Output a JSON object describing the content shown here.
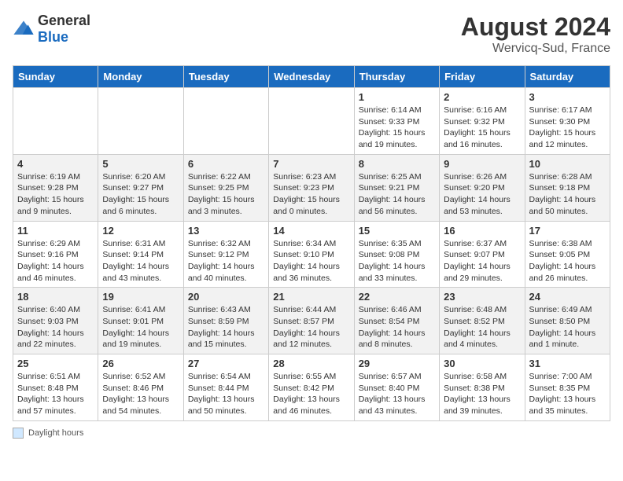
{
  "header": {
    "logo_general": "General",
    "logo_blue": "Blue",
    "month_year": "August 2024",
    "location": "Wervicq-Sud, France"
  },
  "legend": {
    "label": "Daylight hours"
  },
  "days_of_week": [
    "Sunday",
    "Monday",
    "Tuesday",
    "Wednesday",
    "Thursday",
    "Friday",
    "Saturday"
  ],
  "weeks": [
    [
      {
        "day": "",
        "info": ""
      },
      {
        "day": "",
        "info": ""
      },
      {
        "day": "",
        "info": ""
      },
      {
        "day": "",
        "info": ""
      },
      {
        "day": "1",
        "info": "Sunrise: 6:14 AM\nSunset: 9:33 PM\nDaylight: 15 hours and 19 minutes."
      },
      {
        "day": "2",
        "info": "Sunrise: 6:16 AM\nSunset: 9:32 PM\nDaylight: 15 hours and 16 minutes."
      },
      {
        "day": "3",
        "info": "Sunrise: 6:17 AM\nSunset: 9:30 PM\nDaylight: 15 hours and 12 minutes."
      }
    ],
    [
      {
        "day": "4",
        "info": "Sunrise: 6:19 AM\nSunset: 9:28 PM\nDaylight: 15 hours and 9 minutes."
      },
      {
        "day": "5",
        "info": "Sunrise: 6:20 AM\nSunset: 9:27 PM\nDaylight: 15 hours and 6 minutes."
      },
      {
        "day": "6",
        "info": "Sunrise: 6:22 AM\nSunset: 9:25 PM\nDaylight: 15 hours and 3 minutes."
      },
      {
        "day": "7",
        "info": "Sunrise: 6:23 AM\nSunset: 9:23 PM\nDaylight: 15 hours and 0 minutes."
      },
      {
        "day": "8",
        "info": "Sunrise: 6:25 AM\nSunset: 9:21 PM\nDaylight: 14 hours and 56 minutes."
      },
      {
        "day": "9",
        "info": "Sunrise: 6:26 AM\nSunset: 9:20 PM\nDaylight: 14 hours and 53 minutes."
      },
      {
        "day": "10",
        "info": "Sunrise: 6:28 AM\nSunset: 9:18 PM\nDaylight: 14 hours and 50 minutes."
      }
    ],
    [
      {
        "day": "11",
        "info": "Sunrise: 6:29 AM\nSunset: 9:16 PM\nDaylight: 14 hours and 46 minutes."
      },
      {
        "day": "12",
        "info": "Sunrise: 6:31 AM\nSunset: 9:14 PM\nDaylight: 14 hours and 43 minutes."
      },
      {
        "day": "13",
        "info": "Sunrise: 6:32 AM\nSunset: 9:12 PM\nDaylight: 14 hours and 40 minutes."
      },
      {
        "day": "14",
        "info": "Sunrise: 6:34 AM\nSunset: 9:10 PM\nDaylight: 14 hours and 36 minutes."
      },
      {
        "day": "15",
        "info": "Sunrise: 6:35 AM\nSunset: 9:08 PM\nDaylight: 14 hours and 33 minutes."
      },
      {
        "day": "16",
        "info": "Sunrise: 6:37 AM\nSunset: 9:07 PM\nDaylight: 14 hours and 29 minutes."
      },
      {
        "day": "17",
        "info": "Sunrise: 6:38 AM\nSunset: 9:05 PM\nDaylight: 14 hours and 26 minutes."
      }
    ],
    [
      {
        "day": "18",
        "info": "Sunrise: 6:40 AM\nSunset: 9:03 PM\nDaylight: 14 hours and 22 minutes."
      },
      {
        "day": "19",
        "info": "Sunrise: 6:41 AM\nSunset: 9:01 PM\nDaylight: 14 hours and 19 minutes."
      },
      {
        "day": "20",
        "info": "Sunrise: 6:43 AM\nSunset: 8:59 PM\nDaylight: 14 hours and 15 minutes."
      },
      {
        "day": "21",
        "info": "Sunrise: 6:44 AM\nSunset: 8:57 PM\nDaylight: 14 hours and 12 minutes."
      },
      {
        "day": "22",
        "info": "Sunrise: 6:46 AM\nSunset: 8:54 PM\nDaylight: 14 hours and 8 minutes."
      },
      {
        "day": "23",
        "info": "Sunrise: 6:48 AM\nSunset: 8:52 PM\nDaylight: 14 hours and 4 minutes."
      },
      {
        "day": "24",
        "info": "Sunrise: 6:49 AM\nSunset: 8:50 PM\nDaylight: 14 hours and 1 minute."
      }
    ],
    [
      {
        "day": "25",
        "info": "Sunrise: 6:51 AM\nSunset: 8:48 PM\nDaylight: 13 hours and 57 minutes."
      },
      {
        "day": "26",
        "info": "Sunrise: 6:52 AM\nSunset: 8:46 PM\nDaylight: 13 hours and 54 minutes."
      },
      {
        "day": "27",
        "info": "Sunrise: 6:54 AM\nSunset: 8:44 PM\nDaylight: 13 hours and 50 minutes."
      },
      {
        "day": "28",
        "info": "Sunrise: 6:55 AM\nSunset: 8:42 PM\nDaylight: 13 hours and 46 minutes."
      },
      {
        "day": "29",
        "info": "Sunrise: 6:57 AM\nSunset: 8:40 PM\nDaylight: 13 hours and 43 minutes."
      },
      {
        "day": "30",
        "info": "Sunrise: 6:58 AM\nSunset: 8:38 PM\nDaylight: 13 hours and 39 minutes."
      },
      {
        "day": "31",
        "info": "Sunrise: 7:00 AM\nSunset: 8:35 PM\nDaylight: 13 hours and 35 minutes."
      }
    ]
  ]
}
